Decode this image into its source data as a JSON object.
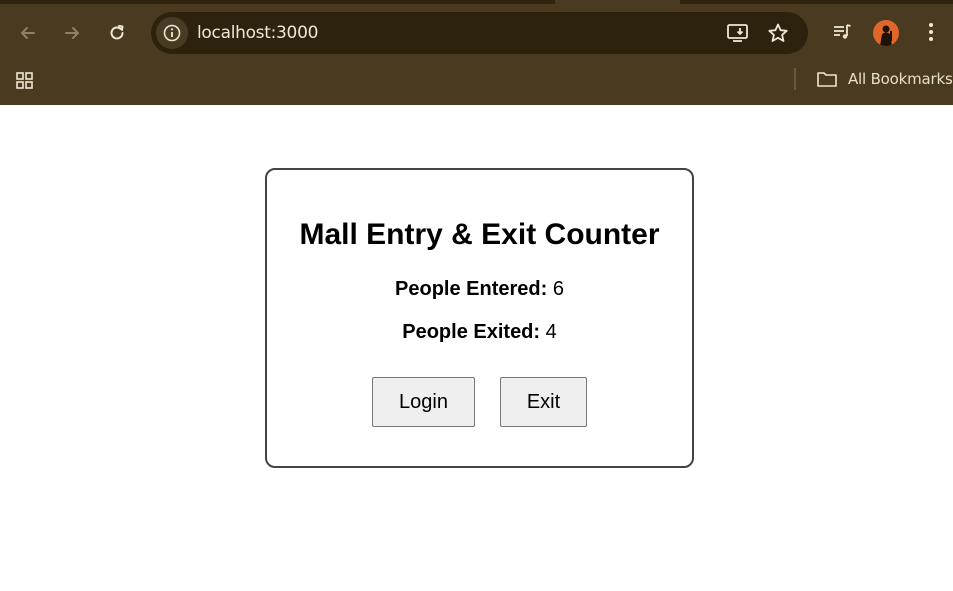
{
  "browser": {
    "url": "localhost:3000",
    "bookmarks_label": "All Bookmarks",
    "avatar_color": "#e0662a",
    "chrome_color": "#4a3a1f"
  },
  "app": {
    "title": "Mall Entry & Exit Counter",
    "entered_label": "People Entered:",
    "entered_value": "6",
    "exited_label": "People Exited:",
    "exited_value": "4",
    "login_button": "Login",
    "exit_button": "Exit"
  }
}
